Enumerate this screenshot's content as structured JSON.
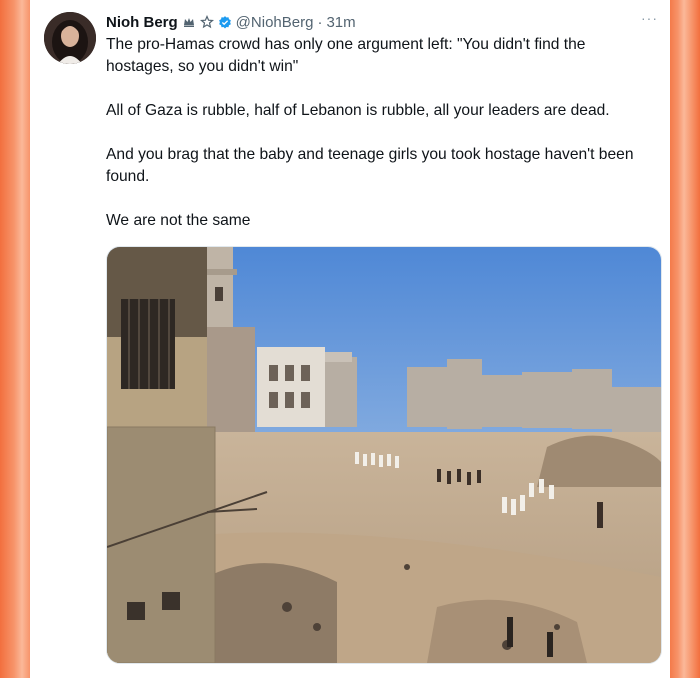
{
  "post": {
    "display_name": "Nioh Berg",
    "handle": "@NiohBerg",
    "separator": "·",
    "time": "31m",
    "more_label": "···",
    "paragraphs": [
      "The pro-Hamas crowd has only one argument left: \"You didn't find the hostages, so you didn't win\"",
      "All of Gaza is rubble, half of Lebanon is rubble, all your leaders are dead.",
      "And you brag that the baby and teenage girls you took hostage haven't been found.",
      "We are not the same"
    ],
    "icons": {
      "crown": "crown-icon",
      "star": "star-icon",
      "verified": "verified-badge-icon",
      "more": "more-options-icon"
    }
  },
  "colors": {
    "frame": "#f47a4a",
    "verified": "#1d9bf0",
    "text": "#0f1419",
    "muted": "#536471"
  }
}
